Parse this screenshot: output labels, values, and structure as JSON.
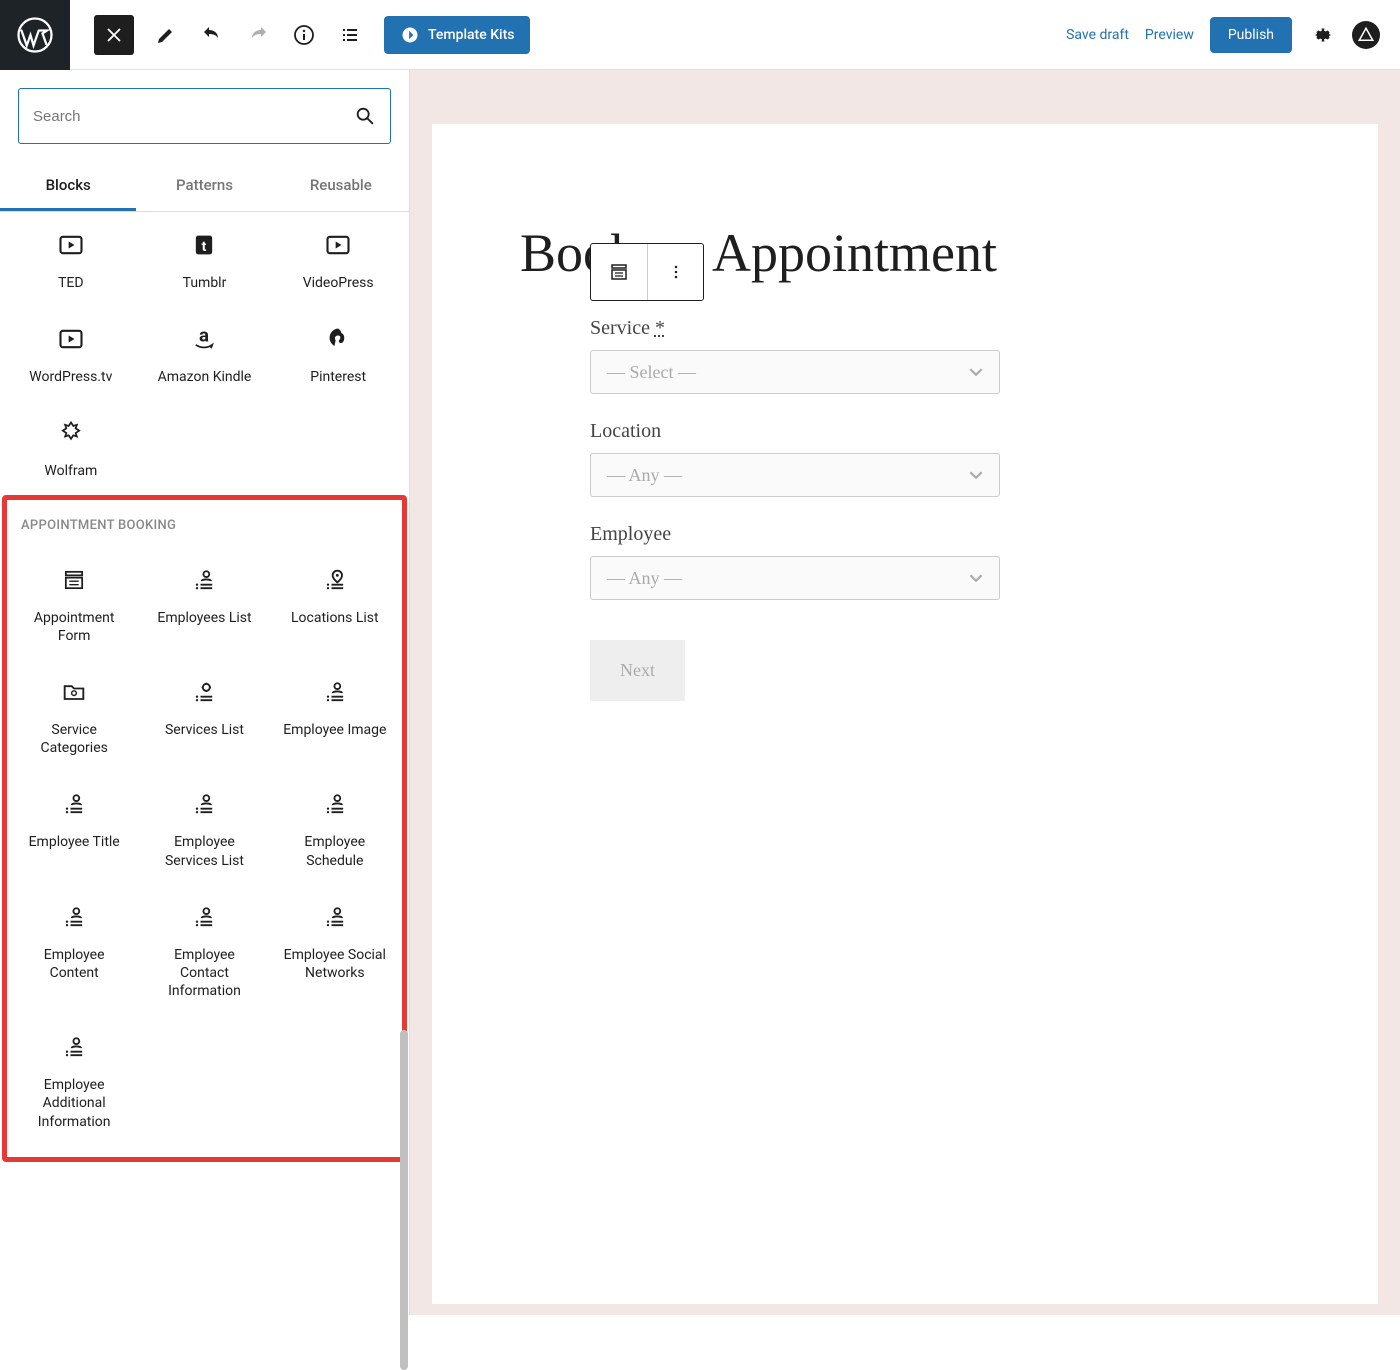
{
  "topbar": {
    "template_kits": "Template Kits",
    "save_draft": "Save draft",
    "preview": "Preview",
    "publish": "Publish"
  },
  "search": {
    "placeholder": "Search"
  },
  "tabs": {
    "blocks": "Blocks",
    "patterns": "Patterns",
    "reusable": "Reusable"
  },
  "embed_blocks": [
    {
      "label": "TED"
    },
    {
      "label": "Tumblr"
    },
    {
      "label": "VideoPress"
    },
    {
      "label": "WordPress.tv"
    },
    {
      "label": "Amazon Kindle"
    },
    {
      "label": "Pinterest"
    },
    {
      "label": "Wolfram"
    }
  ],
  "category": {
    "label": "APPOINTMENT BOOKING",
    "blocks": [
      {
        "label": "Appointment Form"
      },
      {
        "label": "Employees List"
      },
      {
        "label": "Locations List"
      },
      {
        "label": "Service Categories"
      },
      {
        "label": "Services List"
      },
      {
        "label": "Employee Image"
      },
      {
        "label": "Employee Title"
      },
      {
        "label": "Employee Services List"
      },
      {
        "label": "Employee Schedule"
      },
      {
        "label": "Employee Content"
      },
      {
        "label": "Employee Contact Information"
      },
      {
        "label": "Employee Social Networks"
      },
      {
        "label": "Employee Additional Information"
      }
    ]
  },
  "page": {
    "title": "Book an Appointment",
    "form": {
      "service_label": "Service",
      "required_mark": "*",
      "location_label": "Location",
      "employee_label": "Employee",
      "select_placeholder": "— Select —",
      "any_placeholder": "— Any —",
      "next": "Next"
    }
  }
}
